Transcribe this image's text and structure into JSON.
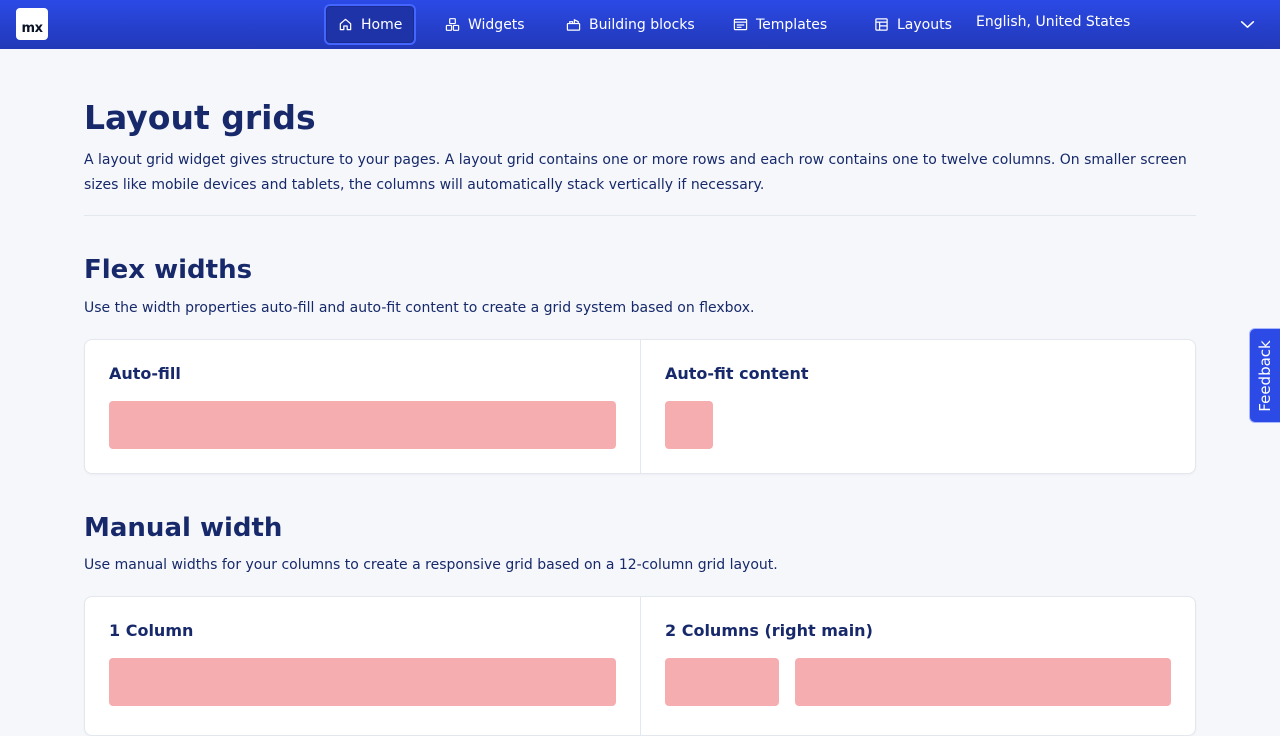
{
  "app": {
    "logo_text": "mx"
  },
  "nav": {
    "items": [
      {
        "label": "Home",
        "icon": "home-icon"
      },
      {
        "label": "Widgets",
        "icon": "widgets-icon"
      },
      {
        "label": "Building blocks",
        "icon": "building-blocks-icon"
      },
      {
        "label": "Templates",
        "icon": "templates-icon"
      },
      {
        "label": "Layouts",
        "icon": "layouts-icon"
      }
    ],
    "active": "Home",
    "language": "English, United States"
  },
  "page": {
    "title": "Layout grids",
    "lead": "A layout grid widget gives structure to your pages. A layout grid contains one or more rows and each row contains one to twelve columns. On smaller screen sizes like mobile devices and tablets, the columns will automatically stack vertically if necessary."
  },
  "sections": [
    {
      "title": "Flex widths",
      "description": "Use the width properties auto-fill and auto-fit content to create a grid system based on flexbox.",
      "columns": [
        {
          "title": "Auto-fill"
        },
        {
          "title": "Auto-fit content"
        }
      ]
    },
    {
      "title": "Manual width",
      "description": "Use manual widths for your columns to create a responsive grid based on a 12-column grid layout.",
      "columns": [
        {
          "title": "1 Column"
        },
        {
          "title": "2 Columns (right main)"
        }
      ]
    }
  ],
  "feedback": {
    "label": "Feedback"
  },
  "colors": {
    "nav_top": "#2b4ae6",
    "nav_bottom": "#2238b8",
    "text": "#17296a",
    "placeholder_block": "#f6adb0",
    "background": "#f5f7fa"
  }
}
